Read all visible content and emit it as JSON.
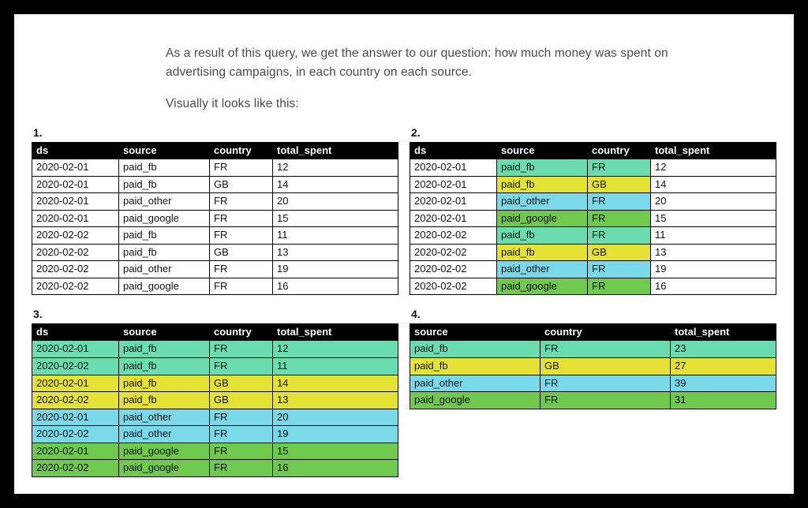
{
  "intro": {
    "p1": "As a result of this query, we get the answer to our question: how much money was spent on advertising campaigns, in each country on each source.",
    "p2": "Visually it looks like this:"
  },
  "colors": {
    "teal": "#6adcb0",
    "yellow": "#e4e235",
    "sky": "#79d9e8",
    "green": "#6ec94c"
  },
  "tables": {
    "t1": {
      "label": "1.",
      "headers": [
        "ds",
        "source",
        "country",
        "total_spent"
      ],
      "rows": [
        {
          "cells": [
            "2020-02-01",
            "paid_fb",
            "FR",
            "12"
          ],
          "fill": [
            null,
            null,
            null,
            null
          ]
        },
        {
          "cells": [
            "2020-02-01",
            "paid_fb",
            "GB",
            "14"
          ],
          "fill": [
            null,
            null,
            null,
            null
          ]
        },
        {
          "cells": [
            "2020-02-01",
            "paid_other",
            "FR",
            "20"
          ],
          "fill": [
            null,
            null,
            null,
            null
          ]
        },
        {
          "cells": [
            "2020-02-01",
            "paid_google",
            "FR",
            "15"
          ],
          "fill": [
            null,
            null,
            null,
            null
          ]
        },
        {
          "cells": [
            "2020-02-02",
            "paid_fb",
            "FR",
            "11"
          ],
          "fill": [
            null,
            null,
            null,
            null
          ]
        },
        {
          "cells": [
            "2020-02-02",
            "paid_fb",
            "GB",
            "13"
          ],
          "fill": [
            null,
            null,
            null,
            null
          ]
        },
        {
          "cells": [
            "2020-02-02",
            "paid_other",
            "FR",
            "19"
          ],
          "fill": [
            null,
            null,
            null,
            null
          ]
        },
        {
          "cells": [
            "2020-02-02",
            "paid_google",
            "FR",
            "16"
          ],
          "fill": [
            null,
            null,
            null,
            null
          ]
        }
      ]
    },
    "t2": {
      "label": "2.",
      "headers": [
        "ds",
        "source",
        "country",
        "total_spent"
      ],
      "rows": [
        {
          "cells": [
            "2020-02-01",
            "paid_fb",
            "FR",
            "12"
          ],
          "fill": [
            null,
            "teal",
            "teal",
            null
          ]
        },
        {
          "cells": [
            "2020-02-01",
            "paid_fb",
            "GB",
            "14"
          ],
          "fill": [
            null,
            "yellow",
            "yellow",
            null
          ]
        },
        {
          "cells": [
            "2020-02-01",
            "paid_other",
            "FR",
            "20"
          ],
          "fill": [
            null,
            "sky",
            "sky",
            null
          ]
        },
        {
          "cells": [
            "2020-02-01",
            "paid_google",
            "FR",
            "15"
          ],
          "fill": [
            null,
            "green",
            "green",
            null
          ]
        },
        {
          "cells": [
            "2020-02-02",
            "paid_fb",
            "FR",
            "11"
          ],
          "fill": [
            null,
            "teal",
            "teal",
            null
          ]
        },
        {
          "cells": [
            "2020-02-02",
            "paid_fb",
            "GB",
            "13"
          ],
          "fill": [
            null,
            "yellow",
            "yellow",
            null
          ]
        },
        {
          "cells": [
            "2020-02-02",
            "paid_other",
            "FR",
            "19"
          ],
          "fill": [
            null,
            "sky",
            "sky",
            null
          ]
        },
        {
          "cells": [
            "2020-02-02",
            "paid_google",
            "FR",
            "16"
          ],
          "fill": [
            null,
            "green",
            "green",
            null
          ]
        }
      ]
    },
    "t3": {
      "label": "3.",
      "headers": [
        "ds",
        "source",
        "country",
        "total_spent"
      ],
      "rows": [
        {
          "cells": [
            "2020-02-01",
            "paid_fb",
            "FR",
            "12"
          ],
          "fill": [
            "teal",
            "teal",
            "teal",
            "teal"
          ]
        },
        {
          "cells": [
            "2020-02-02",
            "paid_fb",
            "FR",
            "11"
          ],
          "fill": [
            "teal",
            "teal",
            "teal",
            "teal"
          ]
        },
        {
          "cells": [
            "2020-02-01",
            "paid_fb",
            "GB",
            "14"
          ],
          "fill": [
            "yellow",
            "yellow",
            "yellow",
            "yellow"
          ]
        },
        {
          "cells": [
            "2020-02-02",
            "paid_fb",
            "GB",
            "13"
          ],
          "fill": [
            "yellow",
            "yellow",
            "yellow",
            "yellow"
          ]
        },
        {
          "cells": [
            "2020-02-01",
            "paid_other",
            "FR",
            "20"
          ],
          "fill": [
            "sky",
            "sky",
            "sky",
            "sky"
          ]
        },
        {
          "cells": [
            "2020-02-02",
            "paid_other",
            "FR",
            "19"
          ],
          "fill": [
            "sky",
            "sky",
            "sky",
            "sky"
          ]
        },
        {
          "cells": [
            "2020-02-01",
            "paid_google",
            "FR",
            "15"
          ],
          "fill": [
            "green",
            "green",
            "green",
            "green"
          ]
        },
        {
          "cells": [
            "2020-02-02",
            "paid_google",
            "FR",
            "16"
          ],
          "fill": [
            "green",
            "green",
            "green",
            "green"
          ]
        }
      ]
    },
    "t4": {
      "label": "4.",
      "headers": [
        "source",
        "country",
        "total_spent"
      ],
      "rows": [
        {
          "cells": [
            "paid_fb",
            "FR",
            "23"
          ],
          "fill": [
            "teal",
            "teal",
            "teal"
          ]
        },
        {
          "cells": [
            "paid_fb",
            "GB",
            "27"
          ],
          "fill": [
            "yellow",
            "yellow",
            "yellow"
          ]
        },
        {
          "cells": [
            "paid_other",
            "FR",
            "39"
          ],
          "fill": [
            "sky",
            "sky",
            "sky"
          ]
        },
        {
          "cells": [
            "paid_google",
            "FR",
            "31"
          ],
          "fill": [
            "green",
            "green",
            "green"
          ]
        }
      ]
    }
  }
}
